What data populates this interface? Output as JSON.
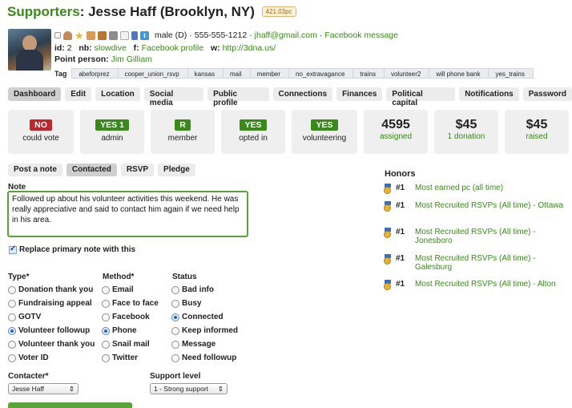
{
  "header": {
    "section": "Supporters",
    "name": "Jesse Haff (Brooklyn, NY)",
    "pc_badge": "421.03pc"
  },
  "profile": {
    "gender_party": "male (D)",
    "phone": "555-555-1212",
    "email": "jhaff@gmail.com",
    "fb_message": "Facebook message",
    "id_label": "id:",
    "id_value": "2",
    "nb_label": "nb:",
    "nb_value": "slowdive",
    "f_label": "f:",
    "f_value": "Facebook profile",
    "w_label": "w:",
    "w_value": "http://3dna.us/",
    "point_person_label": "Point person:",
    "point_person": "Jim Gilliam",
    "tag_label": "Tag",
    "tags": [
      "abeforprez",
      "cooper_union_rsvp",
      "kansas",
      "mail",
      "member",
      "no_extravagance",
      "trains",
      "volunteer2",
      "will phone bank",
      "yes_trains"
    ],
    "icons": [
      "person-icon",
      "star-icon",
      "hand-icon",
      "donation-icon",
      "bank-icon",
      "mail-icon",
      "phone-icon",
      "twitter-icon"
    ]
  },
  "tabs": [
    "Dashboard",
    "Edit",
    "Location",
    "Social media",
    "Public profile",
    "Connections",
    "Finances",
    "Political capital",
    "Notifications",
    "Password"
  ],
  "cards": [
    {
      "badge": "NO",
      "label": "could vote",
      "color": "#c0272d"
    },
    {
      "badge": "YES 1",
      "label": "admin",
      "color": "#3a8a1a"
    },
    {
      "badge": "R",
      "label": "member",
      "color": "#3a8a1a"
    },
    {
      "badge": "YES",
      "label": "opted in",
      "color": "#3a8a1a"
    },
    {
      "badge": "YES",
      "label": "volunteering",
      "color": "#3a8a1a"
    }
  ],
  "stats": [
    {
      "value": "4595",
      "label": "assigned"
    },
    {
      "value": "$45",
      "label": "1 donation"
    },
    {
      "value": "$45",
      "label": "raised"
    }
  ],
  "subtabs": [
    "Post a note",
    "Contacted",
    "RSVP",
    "Pledge"
  ],
  "note": {
    "label": "Note",
    "text": "Followed up about his volunteer activities this weekend. He was really appreciative and said to contact him again if we need help in his area."
  },
  "replace_label": "Replace primary note with this",
  "type": {
    "heading": "Type*",
    "options": [
      "Donation thank you",
      "Fundraising appeal",
      "GOTV",
      "Volunteer followup",
      "Volunteer thank you",
      "Voter ID"
    ],
    "selected": "Volunteer followup"
  },
  "method": {
    "heading": "Method*",
    "options": [
      "Email",
      "Face to face",
      "Facebook",
      "Phone",
      "Snail mail",
      "Twitter"
    ],
    "selected": "Phone"
  },
  "status": {
    "heading": "Status",
    "options": [
      "Bad info",
      "Busy",
      "Connected",
      "Keep informed",
      "Message",
      "Need followup"
    ],
    "selected": "Connected"
  },
  "contacter": {
    "label": "Contacter*",
    "value": "Jesse Haff"
  },
  "support_level": {
    "label": "Support level",
    "value": "1 - Strong support"
  },
  "honors": {
    "title": "Honors",
    "items": [
      {
        "rank": "#1",
        "title": "Most earned pc (all time)"
      },
      {
        "rank": "#1",
        "title": "Most Recruited RSVPs (All time) - Ottawa"
      },
      {
        "rank": "#1",
        "title": "Most Recruited RSVPs (All time) - Jonesboro"
      },
      {
        "rank": "#1",
        "title": "Most Recruited RSVPs (All time) - Galesburg"
      },
      {
        "rank": "#1",
        "title": "Most Recruited RSVPs (All time) - Alton"
      }
    ]
  }
}
